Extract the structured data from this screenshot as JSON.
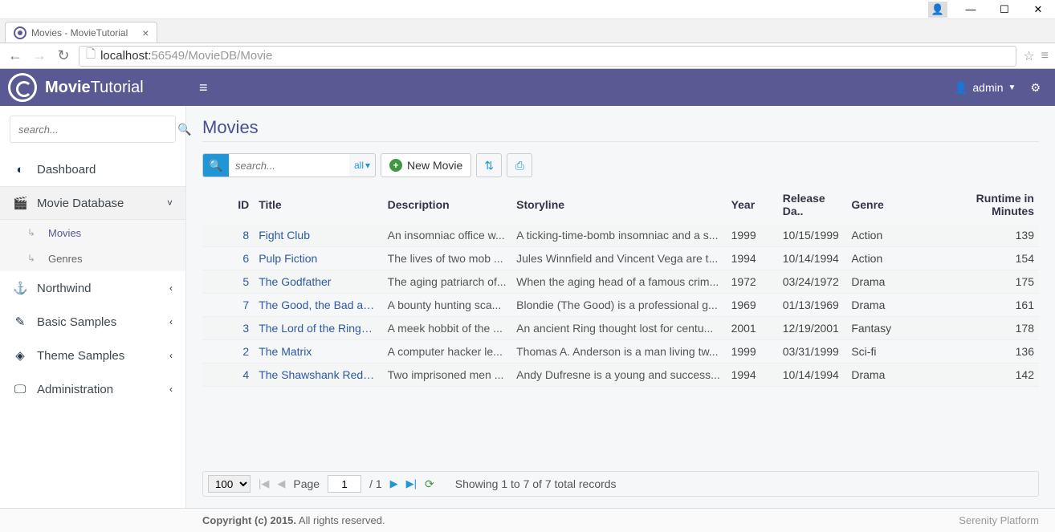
{
  "window": {
    "tab_title": "Movies - MovieTutorial"
  },
  "browser": {
    "url_host": "localhost:",
    "url_port": "56549",
    "url_path": "/MovieDB/Movie"
  },
  "header": {
    "brand_main": "Movie",
    "brand_sub": "Tutorial",
    "user": "admin"
  },
  "sidebar": {
    "search_placeholder": "search...",
    "items": [
      {
        "icon": "tachometer",
        "label": "Dashboard",
        "chev": ""
      },
      {
        "icon": "film",
        "label": "Movie Database",
        "chev": "˅",
        "active": true,
        "children": [
          {
            "icon": "sub",
            "label": "Movies",
            "current": true
          },
          {
            "icon": "sub",
            "label": "Genres",
            "current": false
          }
        ]
      },
      {
        "icon": "anchor",
        "label": "Northwind",
        "chev": "‹"
      },
      {
        "icon": "wand",
        "label": "Basic Samples",
        "chev": "‹"
      },
      {
        "icon": "diamond",
        "label": "Theme Samples",
        "chev": "‹"
      },
      {
        "icon": "desktop",
        "label": "Administration",
        "chev": "‹"
      }
    ]
  },
  "page": {
    "title": "Movies"
  },
  "toolbar": {
    "search_placeholder": "search...",
    "all_label": "all",
    "new_label": "New Movie"
  },
  "grid": {
    "columns": [
      "ID",
      "Title",
      "Description",
      "Storyline",
      "Year",
      "Release Da..",
      "Genre",
      "Runtime in Minutes"
    ],
    "rows": [
      {
        "id": 8,
        "title": "Fight Club",
        "desc": "An insomniac office w...",
        "story": "A ticking-time-bomb insomniac and a s...",
        "year": "1999",
        "rel": "10/15/1999",
        "genre": "Action",
        "run": 139
      },
      {
        "id": 6,
        "title": "Pulp Fiction",
        "desc": "The lives of two mob ...",
        "story": "Jules Winnfield and Vincent Vega are t...",
        "year": "1994",
        "rel": "10/14/1994",
        "genre": "Action",
        "run": 154
      },
      {
        "id": 5,
        "title": "The Godfather",
        "desc": "The aging patriarch of...",
        "story": "When the aging head of a famous crim...",
        "year": "1972",
        "rel": "03/24/1972",
        "genre": "Drama",
        "run": 175
      },
      {
        "id": 7,
        "title": "The Good, the Bad an...",
        "desc": "A bounty hunting sca...",
        "story": "Blondie (The Good) is a professional g...",
        "year": "1969",
        "rel": "01/13/1969",
        "genre": "Drama",
        "run": 161
      },
      {
        "id": 3,
        "title": "The Lord of the Rings:...",
        "desc": "A meek hobbit of the ...",
        "story": "An ancient Ring thought lost for centu...",
        "year": "2001",
        "rel": "12/19/2001",
        "genre": "Fantasy",
        "run": 178
      },
      {
        "id": 2,
        "title": "The Matrix",
        "desc": "A computer hacker le...",
        "story": "Thomas A. Anderson is a man living tw...",
        "year": "1999",
        "rel": "03/31/1999",
        "genre": "Sci-fi",
        "run": 136
      },
      {
        "id": 4,
        "title": "The Shawshank Rede...",
        "desc": "Two imprisoned men ...",
        "story": "Andy Dufresne is a young and success...",
        "year": "1994",
        "rel": "10/14/1994",
        "genre": "Drama",
        "run": 142
      }
    ]
  },
  "pager": {
    "page_size": "100",
    "page_label": "Page",
    "page": "1",
    "page_of": "/ 1",
    "status": "Showing 1 to 7 of 7 total records"
  },
  "footer": {
    "copyright_strong": "Copyright (c) 2015.",
    "copyright_rest": " All rights reserved.",
    "platform": "Serenity Platform"
  }
}
